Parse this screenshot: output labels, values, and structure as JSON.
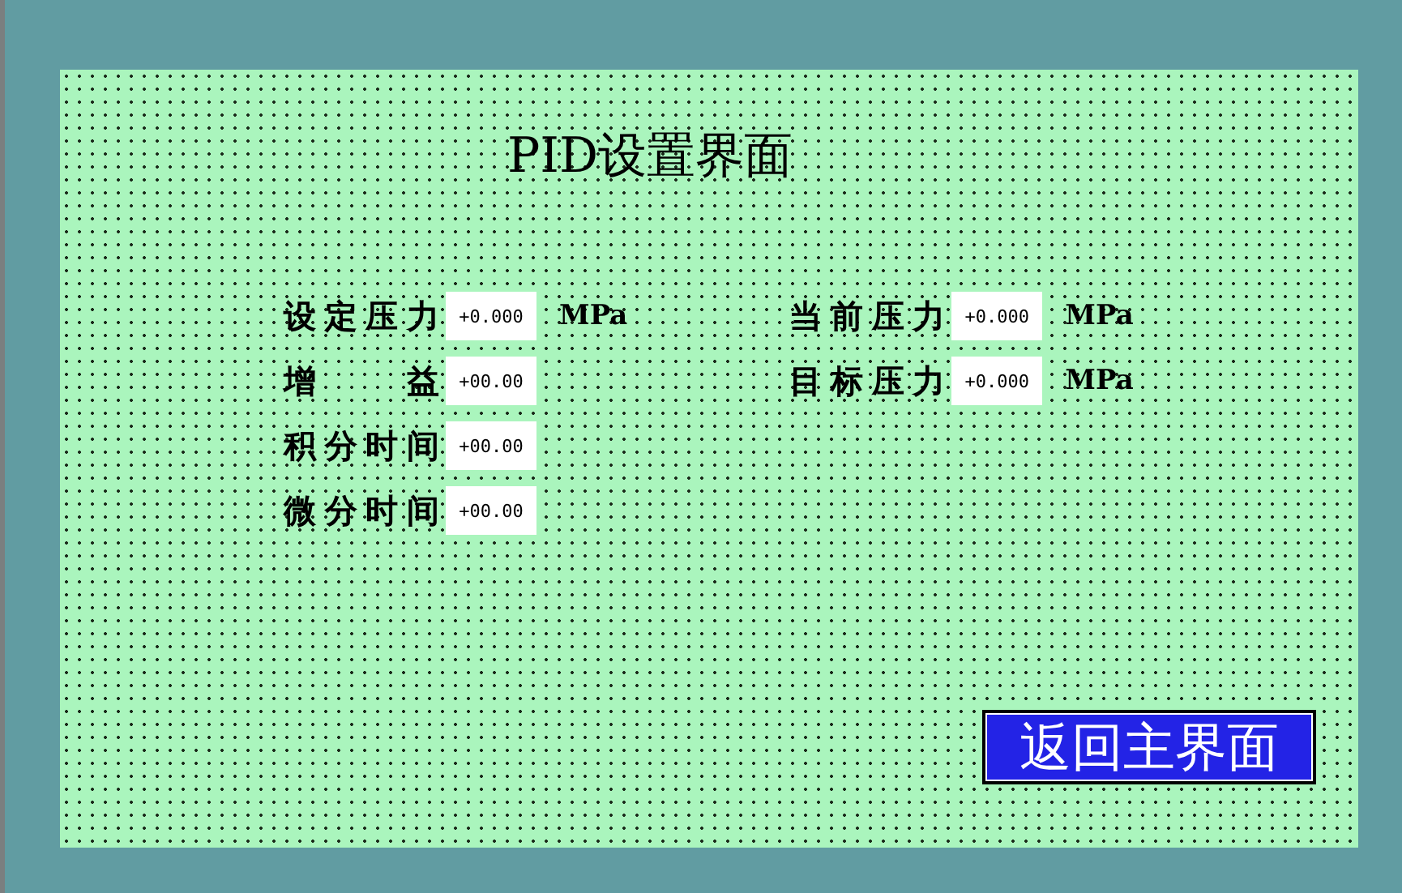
{
  "title": "PID设置界面",
  "left_fields": [
    {
      "label": "设定压力",
      "value": "+0.000",
      "unit": "MPa"
    },
    {
      "label": "增益",
      "value": "+00.00"
    },
    {
      "label": "积分时间",
      "value": "+00.00"
    },
    {
      "label": "微分时间",
      "value": "+00.00"
    }
  ],
  "right_fields": [
    {
      "label": "当前压力",
      "value": "+0.000",
      "unit": "MPa"
    },
    {
      "label": "目标压力",
      "value": "+0.000",
      "unit": "MPa"
    }
  ],
  "back_button": "返回主界面"
}
